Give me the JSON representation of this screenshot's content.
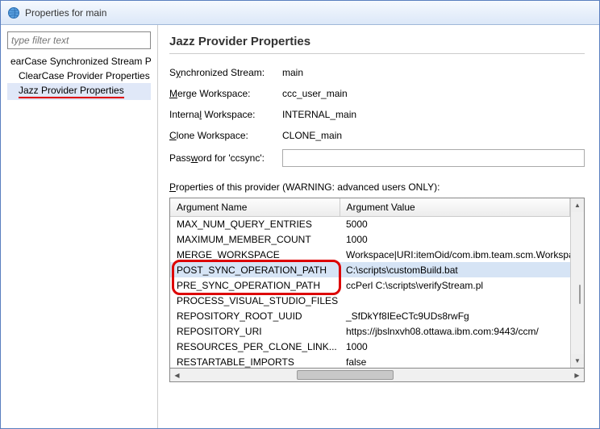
{
  "window": {
    "title": "Properties for main"
  },
  "sidebar": {
    "filter_placeholder": "type filter text",
    "items": [
      {
        "label": "earCase Synchronized Stream Pr"
      },
      {
        "label": "ClearCase Provider Properties"
      },
      {
        "label": "Jazz Provider Properties"
      }
    ]
  },
  "content": {
    "heading": "Jazz Provider Properties",
    "form": {
      "sync_stream": {
        "label_pre": "S",
        "label_u": "y",
        "label_post": "nchronized Stream:",
        "value": "main"
      },
      "merge_ws": {
        "label_u": "M",
        "label_post": "erge Workspace:",
        "value": "ccc_user_main"
      },
      "internal_ws": {
        "label_pre": "Interna",
        "label_u": "l",
        "label_post": " Workspace:",
        "value": "INTERNAL_main"
      },
      "clone_ws": {
        "label_u": "C",
        "label_post": "lone Workspace:",
        "value": "CLONE_main"
      },
      "password": {
        "label_pre": "Pass",
        "label_u": "w",
        "label_post": "ord for 'ccsync':",
        "value": ""
      }
    },
    "props_label": {
      "u": "P",
      "post": "roperties of this provider (WARNING: advanced users ONLY):"
    },
    "table": {
      "headers": {
        "name": "Argument Name",
        "value": "Argument Value"
      },
      "rows": [
        {
          "name": "MAX_NUM_QUERY_ENTRIES",
          "value": "5000"
        },
        {
          "name": "MAXIMUM_MEMBER_COUNT",
          "value": "1000"
        },
        {
          "name": "MERGE_WORKSPACE",
          "value": "Workspace|URI:itemOid/com.ibm.team.scm.Workspace/_rix"
        },
        {
          "name": "POST_SYNC_OPERATION_PATH",
          "value": "C:\\scripts\\customBuild.bat",
          "selected": true
        },
        {
          "name": "PRE_SYNC_OPERATION_PATH",
          "value": "ccPerl C:\\scripts\\verifyStream.pl"
        },
        {
          "name": "PROCESS_VISUAL_STUDIO_FILES",
          "value": ""
        },
        {
          "name": "REPOSITORY_ROOT_UUID",
          "value": "_SfDkYf8IEeCTc9UDs8rwFg"
        },
        {
          "name": "REPOSITORY_URI",
          "value": "https://jbslnxvh08.ottawa.ibm.com:9443/ccm/"
        },
        {
          "name": "RESOURCES_PER_CLONE_LINK...",
          "value": "1000"
        },
        {
          "name": "RESTARTABLE_IMPORTS",
          "value": "false"
        }
      ]
    }
  }
}
